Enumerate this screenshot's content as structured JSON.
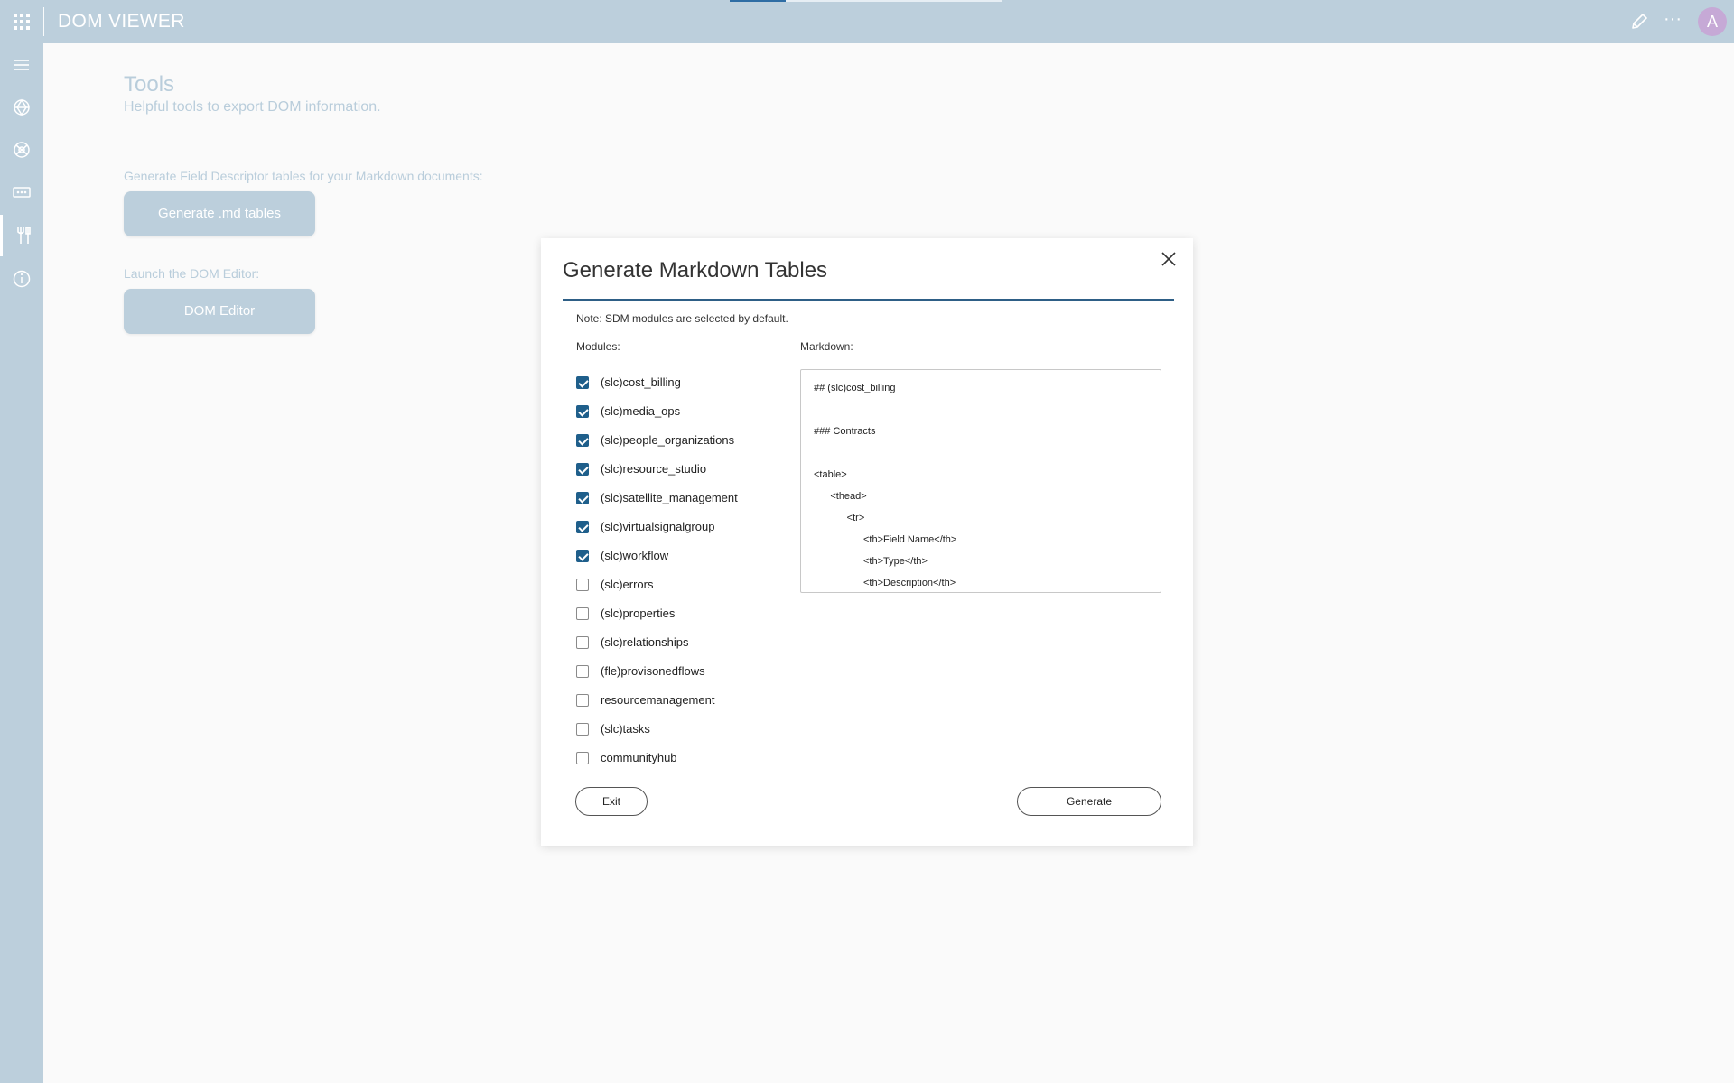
{
  "app": {
    "title": "DOM VIEWER",
    "avatar_initial": "A"
  },
  "colors": {
    "accent": "#1f5f8b",
    "chrome": "#bccfdc",
    "rule": "#2e5f86"
  },
  "sidebar": {
    "items": [
      {
        "name": "menu-icon"
      },
      {
        "name": "modules-icon"
      },
      {
        "name": "definitions-icon"
      },
      {
        "name": "fields-icon"
      },
      {
        "name": "tools-icon",
        "active": true
      },
      {
        "name": "info-icon"
      }
    ]
  },
  "page": {
    "title": "Tools",
    "subtitle": "Helpful tools to export DOM information.",
    "section1_label": "Generate Field Descriptor tables for your Markdown documents:",
    "generate_md_button": "Generate .md tables",
    "section2_label": "Launch the DOM Editor:",
    "dom_editor_button": "DOM Editor"
  },
  "dialog": {
    "title": "Generate Markdown Tables",
    "note": "Note: SDM modules are selected by default.",
    "modules_label": "Modules:",
    "markdown_label": "Markdown:",
    "modules": [
      {
        "label": "(slc)cost_billing",
        "checked": true
      },
      {
        "label": "(slc)media_ops",
        "checked": true
      },
      {
        "label": "(slc)people_organizations",
        "checked": true
      },
      {
        "label": "(slc)resource_studio",
        "checked": true
      },
      {
        "label": "(slc)satellite_management",
        "checked": true
      },
      {
        "label": "(slc)virtualsignalgroup",
        "checked": true
      },
      {
        "label": "(slc)workflow",
        "checked": true
      },
      {
        "label": "(slc)errors",
        "checked": false
      },
      {
        "label": "(slc)properties",
        "checked": false
      },
      {
        "label": "(slc)relationships",
        "checked": false
      },
      {
        "label": "(fle)provisonedflows",
        "checked": false
      },
      {
        "label": "resourcemanagement",
        "checked": false
      },
      {
        "label": "(slc)tasks",
        "checked": false
      },
      {
        "label": "communityhub",
        "checked": false
      }
    ],
    "markdown_text": "## (slc)cost_billing\n\n### Contracts\n\n<table>\n      <thead>\n            <tr>\n                  <th>Field Name</th>\n                  <th>Type</th>\n                  <th>Description</th>",
    "exit_button": "Exit",
    "generate_button": "Generate"
  }
}
